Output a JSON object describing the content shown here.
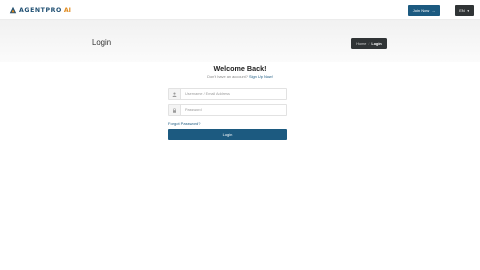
{
  "brand": {
    "name": "AGENTPRO",
    "suffix": "AI",
    "accent_color": "#1c5a80",
    "highlight_color": "#e08a1e"
  },
  "nav": {
    "join_label": "Join Now",
    "join_icon": "arrow-right-icon",
    "language_label": "EN",
    "language_icon": "chevron-down-icon"
  },
  "page": {
    "title": "Login",
    "breadcrumb": {
      "home": "Home",
      "separator": "/",
      "current": "Login"
    }
  },
  "form": {
    "heading": "Welcome Back!",
    "subheading": "Don't have an account?",
    "signup_link": "Sign Up Now!",
    "username": {
      "placeholder": "Username / Email Address",
      "value": "",
      "icon": "user-icon"
    },
    "password": {
      "placeholder": "Password",
      "value": "",
      "icon": "lock-icon"
    },
    "forgot_label": "Forgot Password?",
    "submit_label": "Login"
  }
}
